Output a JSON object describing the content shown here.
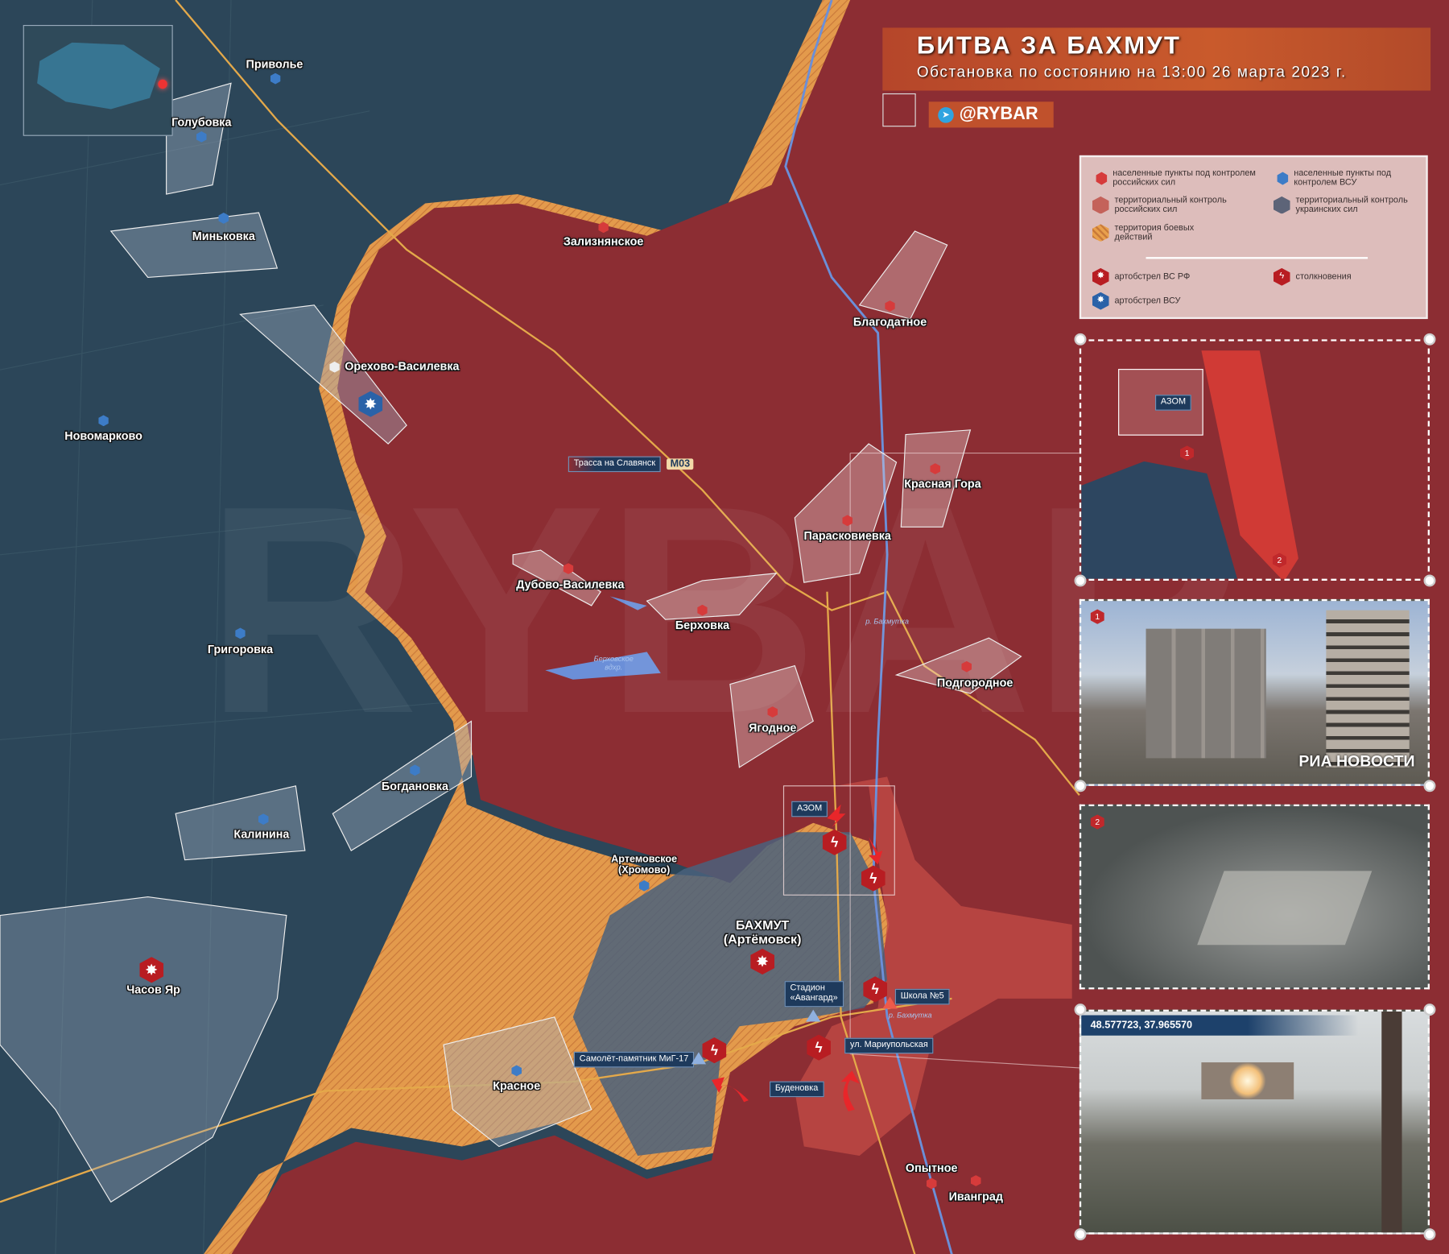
{
  "header": {
    "title": "БИТВА ЗА БАХМУТ",
    "subtitle": "Обстановка по состоянию на 13:00 26 марта 2023 г.",
    "channel": "@RYBAR",
    "channel_icon": "telegram-icon"
  },
  "colors": {
    "russian_control": "#8c2d33",
    "ukrainian_control": "#2c4659",
    "combat_zone": "#e39a4c",
    "accent": "#c0512c"
  },
  "legend": {
    "ru_settlements": "населенные пункты под контролем российских сил",
    "ua_settlements": "населенные пункты под контролем ВСУ",
    "ru_territory": "территориальный контроль российских сил",
    "ua_territory": "территориальный контроль украинских сил",
    "combat": "территория боевых действий",
    "art_ru": "артобстрел ВС РФ",
    "clash": "столкновения",
    "art_ua": "артобстрел ВСУ"
  },
  "settlements": [
    {
      "name": "Приволье",
      "side": "ua"
    },
    {
      "name": "Голубовка",
      "side": "ua"
    },
    {
      "name": "Миньковка",
      "side": "ua"
    },
    {
      "name": "Орехово-Василевка",
      "side": "contested"
    },
    {
      "name": "Новомарково",
      "side": "ua"
    },
    {
      "name": "Зализнянское",
      "side": "ru"
    },
    {
      "name": "Благодатное",
      "side": "ru"
    },
    {
      "name": "Красная Гора",
      "side": "ru"
    },
    {
      "name": "Парасковиевка",
      "side": "ru"
    },
    {
      "name": "Дубово-Василевка",
      "side": "ru"
    },
    {
      "name": "Берховка",
      "side": "ru"
    },
    {
      "name": "Григоровка",
      "side": "ua"
    },
    {
      "name": "Подгородное",
      "side": "ru"
    },
    {
      "name": "Ягодное",
      "side": "ru"
    },
    {
      "name": "Богдановка",
      "side": "ua"
    },
    {
      "name": "Калинина",
      "side": "ua"
    },
    {
      "name": "Артемовское (Хромово)",
      "side": "ua"
    },
    {
      "name": "Часов Яр",
      "side": "ua"
    },
    {
      "name": "Красное",
      "side": "ua"
    },
    {
      "name": "Опытное",
      "side": "ru"
    },
    {
      "name": "Иванград",
      "side": "ru"
    }
  ],
  "city": {
    "name": "БАХМУТ",
    "alt": "(Артёмовск)"
  },
  "map_tags": {
    "highway": "Трасса на Славянск",
    "road_code": "М03",
    "azom": "АЗОМ",
    "stadium": "Стадион «Авангард»",
    "school": "Школа №5",
    "river": "р. Бахмутка",
    "street": "ул. Мариупольская",
    "mig": "Самолёт-памятник МиГ-17",
    "budenovka": "Буденовка",
    "reservoir": "Берховское вдхр."
  },
  "insets": {
    "map": {
      "tag": "АЗОМ",
      "markers": [
        "1",
        "2"
      ]
    },
    "photo1": {
      "badge": "1",
      "watermark": "РИА НОВОСТИ"
    },
    "photo2": {
      "badge": "2"
    },
    "photo3": {
      "coordinates": "48.577723, 37.965570"
    }
  }
}
